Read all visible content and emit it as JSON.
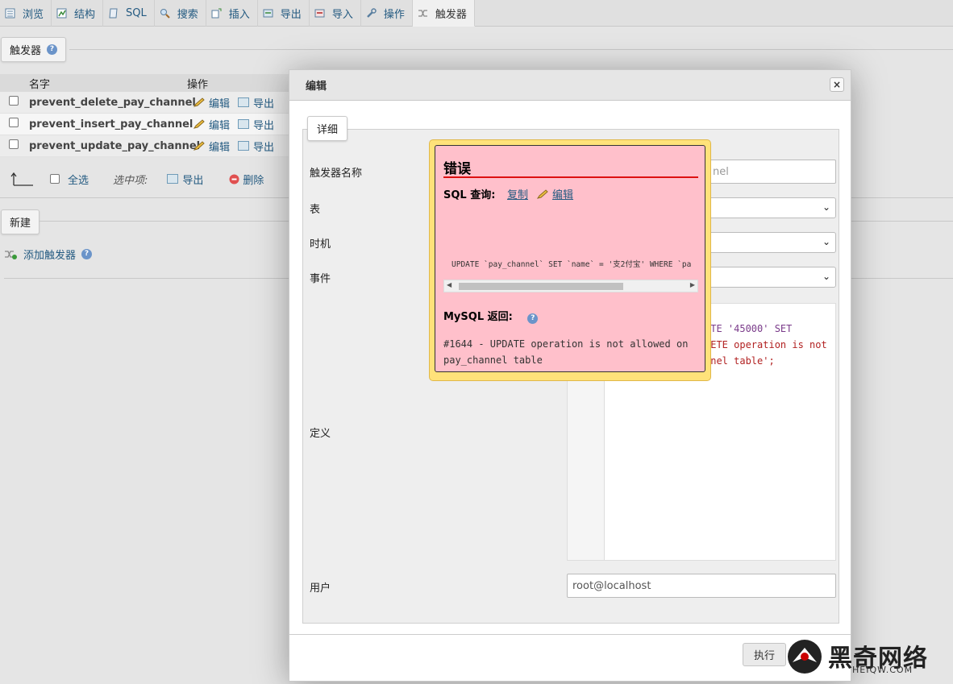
{
  "tabs": [
    {
      "label": "浏览",
      "icon": "browse-icon"
    },
    {
      "label": "结构",
      "icon": "structure-icon"
    },
    {
      "label": "SQL",
      "icon": "sql-icon"
    },
    {
      "label": "搜索",
      "icon": "search-icon"
    },
    {
      "label": "插入",
      "icon": "insert-icon"
    },
    {
      "label": "导出",
      "icon": "export-icon"
    },
    {
      "label": "导入",
      "icon": "import-icon"
    },
    {
      "label": "操作",
      "icon": "wrench-icon"
    },
    {
      "label": "触发器",
      "icon": "trigger-icon"
    }
  ],
  "left": {
    "section_title": "触发器",
    "table_headers": {
      "name": "名字",
      "actions": "操作"
    },
    "rows": [
      {
        "name": "prevent_delete_pay_channel",
        "edit": "编辑",
        "export": "导出"
      },
      {
        "name": "prevent_insert_pay_channel",
        "edit": "编辑",
        "export": "导出"
      },
      {
        "name": "prevent_update_pay_channel",
        "edit": "编辑",
        "export": "导出"
      }
    ],
    "select_all": "全选",
    "with_selected": "选中项:",
    "bulk_export": "导出",
    "bulk_delete": "删除",
    "new_section": "新建",
    "add_trigger": "添加触发器"
  },
  "modal": {
    "title": "编辑",
    "close": "×",
    "legend": "详细",
    "labels": {
      "trigger_name": "触发器名称",
      "table": "表",
      "timing": "时机",
      "event": "事件",
      "definition": "定义",
      "user": "用户"
    },
    "trigger_name_value": "nel",
    "definition_lines": [
      {
        "text": "ATE '45000' SET",
        "color": "#7a3b8a"
      },
      {
        "text": "LETE operation is not",
        "color": "#b22222"
      },
      {
        "text": "nnel table';",
        "color": "#b22222"
      }
    ],
    "user_value": "root@localhost",
    "submit": "执行"
  },
  "error": {
    "title": "错误",
    "sql_query_label": "SQL 查询:",
    "copy": "复制",
    "edit": "编辑",
    "sql_text": "UPDATE `pay_channel` SET `name` = '支2付宝' WHERE `pa",
    "mysql_return_label": "MySQL 返回:",
    "message": "#1644 - UPDATE operation is not allowed on pay_channel table"
  },
  "watermark": {
    "text": "黑奇网络",
    "sub": "HEIQW.COM"
  },
  "colors": {
    "link": "#235a81",
    "error_bg": "#ffc0cb",
    "error_border": "#ffe27a",
    "error_line": "#dd1111"
  }
}
